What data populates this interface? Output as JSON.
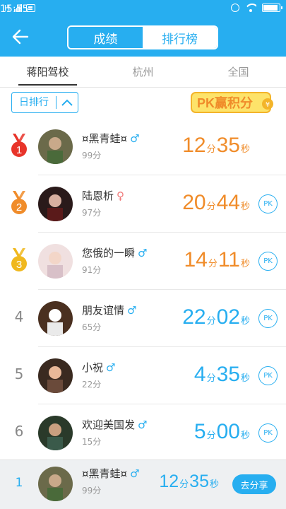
{
  "status_bar": {
    "signal": "H",
    "time": "15:55",
    "battery_level": 0.85,
    "icons": [
      "signal-icon",
      "message-icon",
      "alarm-icon",
      "wifi-icon",
      "battery-icon"
    ]
  },
  "header": {
    "back_icon": "back-arrow-icon",
    "tabs": [
      {
        "label": "成绩",
        "active": true
      },
      {
        "label": "排行榜",
        "active": false
      }
    ]
  },
  "regions": [
    {
      "label": "蒋阳驾校",
      "active": true
    },
    {
      "label": "杭州",
      "active": false
    },
    {
      "label": "全国",
      "active": false
    }
  ],
  "filter": {
    "label": "日排行",
    "icon": "chevron-up-icon"
  },
  "pk_banner": {
    "text": "PK赢积分",
    "currency": "¥"
  },
  "units": {
    "minute": "分",
    "second": "秒"
  },
  "pk_label": "PK",
  "rankings": [
    {
      "rank": "1",
      "medal": "gold-red",
      "name": "¤黑青蛙¤",
      "gender": "♂",
      "gender_type": "male",
      "points": "99分",
      "min": "12",
      "sec": "35",
      "color": "orange",
      "pk": false
    },
    {
      "rank": "2",
      "medal": "orange",
      "name": "陆恩析",
      "gender": "♀",
      "gender_type": "female",
      "points": "97分",
      "min": "20",
      "sec": "44",
      "color": "orange",
      "pk": true
    },
    {
      "rank": "3",
      "medal": "gold",
      "name": "您俄的一瞬",
      "gender": "♂",
      "gender_type": "male",
      "points": "91分",
      "min": "14",
      "sec": "11",
      "color": "orange",
      "pk": true
    },
    {
      "rank": "4",
      "medal": "",
      "name": "朋友谊情",
      "gender": "♂",
      "gender_type": "male",
      "points": "65分",
      "min": "22",
      "sec": "02",
      "color": "blue",
      "pk": true
    },
    {
      "rank": "5",
      "medal": "",
      "name": "小祝",
      "gender": "♂",
      "gender_type": "male",
      "points": "22分",
      "min": "4",
      "sec": "35",
      "color": "blue",
      "pk": true
    },
    {
      "rank": "6",
      "medal": "",
      "name": "欢迎美国发",
      "gender": "♂",
      "gender_type": "male",
      "points": "15分",
      "min": "5",
      "sec": "00",
      "color": "blue",
      "pk": true
    }
  ],
  "my_rank": {
    "rank": "1",
    "name": "¤黑青蛙¤",
    "gender": "♂",
    "points": "99分",
    "min": "12",
    "sec": "35",
    "share_label": "去分享"
  },
  "colors": {
    "accent": "#27aef0",
    "orange": "#f08c2a",
    "medal_red": "#e8342a",
    "medal_orange": "#f08c2a",
    "medal_gold": "#f0b81e"
  }
}
